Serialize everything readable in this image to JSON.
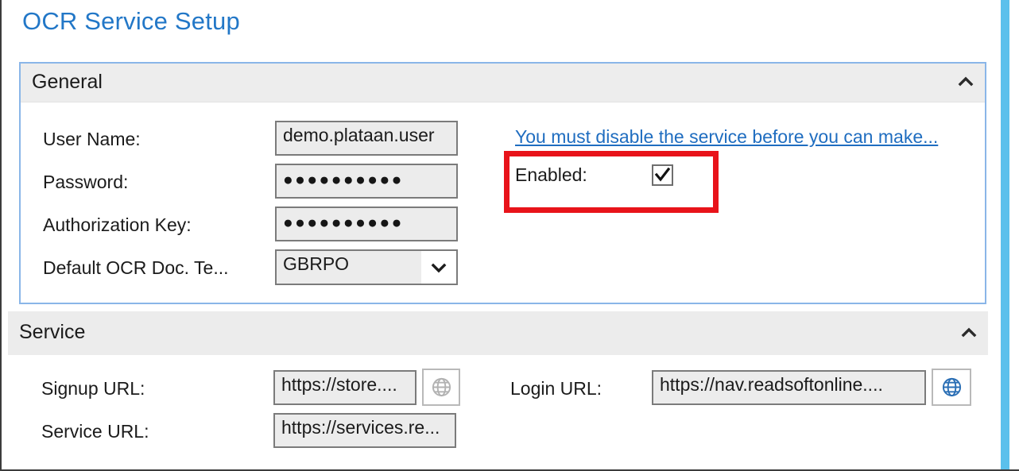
{
  "page": {
    "title": "OCR Service Setup",
    "accent_color": "#2277c7",
    "highlight_color": "#e8131a",
    "scrollbar_color": "#5bc0ec"
  },
  "sections": [
    {
      "id": "general",
      "title": "General",
      "collapse_icon": "chevron-up-icon",
      "collapse_glyph": "⌃",
      "fields": [
        {
          "label": "User Name:",
          "value": "demo.plataan.user",
          "type": "text"
        },
        {
          "label": "Password:",
          "value": "●●●●●●●●●●",
          "type": "password"
        },
        {
          "label": "Authorization Key:",
          "value": "●●●●●●●●●●",
          "type": "password"
        },
        {
          "label": "Default OCR Doc. Te...",
          "value": "GBRPO",
          "type": "dropdown",
          "arrow_glyph": "⌄"
        }
      ],
      "notice": "You must disable the service before you can make...",
      "enabled": {
        "label": "Enabled:",
        "checked": true,
        "check_glyph": "✔"
      }
    },
    {
      "id": "service",
      "title": "Service",
      "collapse_icon": "chevron-up-icon",
      "collapse_glyph": "⌃",
      "fields": [
        {
          "label": "Signup URL:",
          "value": "https://store....",
          "type": "text",
          "has_globe": true,
          "globe_enabled": false
        },
        {
          "label": "Service URL:",
          "value": "https://services.re...",
          "type": "text",
          "has_globe": false
        },
        {
          "label": "Login URL:",
          "value": "https://nav.readsoftonline....",
          "type": "text",
          "has_globe": true,
          "globe_enabled": true
        }
      ]
    }
  ]
}
